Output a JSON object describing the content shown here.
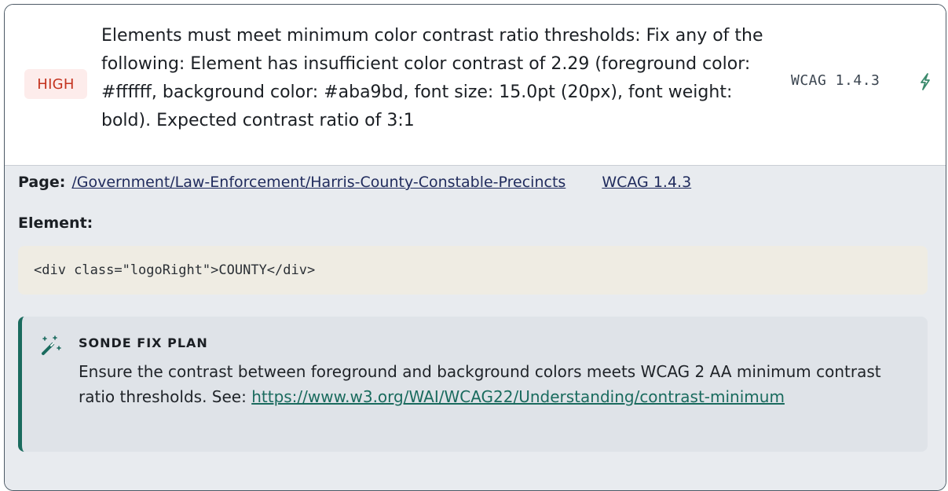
{
  "issue": {
    "severity": "HIGH",
    "title": "Elements must meet minimum color contrast ratio thresholds: Fix any of the following: Element has insufficient color contrast of 2.29 (foreground color: #ffffff, background color: #aba9bd, font size: 15.0pt (20px), font weight: bold). Expected contrast ratio of 3:1",
    "wcag_ref": "WCAG 1.4.3",
    "fix_icon": "magic-wand-icon"
  },
  "details": {
    "page_label": "Page:",
    "page_path": "/Government/Law-Enforcement/Harris-County-Constable-Precincts",
    "wcag_link": "WCAG 1.4.3",
    "element_label": "Element:",
    "element_code": "<div class=\"logoRight\">COUNTY</div>"
  },
  "fix_plan": {
    "icon": "magic-wand-sparkle-icon",
    "title": "SONDE FIX PLAN",
    "body_text": "Ensure the contrast between foreground and background colors meets WCAG 2 AA minimum contrast ratio thresholds. See: ",
    "link_text": "https://www.w3.org/WAI/WCAG22/Understanding/contrast-minimum"
  },
  "colors": {
    "severity_text": "#c4331f",
    "severity_bg": "#fdeceb",
    "accent": "#1a6b5e",
    "details_bg": "#e8ebef",
    "code_bg": "#efece3"
  }
}
